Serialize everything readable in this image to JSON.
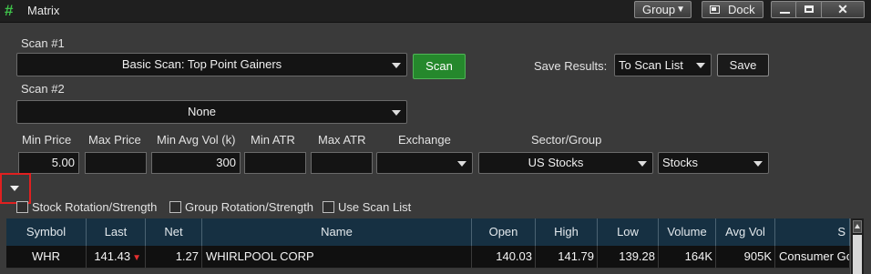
{
  "window": {
    "title": "Matrix",
    "group_label": "Group",
    "dock_label": "Dock",
    "close_glyph": "✕"
  },
  "scan1": {
    "label": "Scan #1",
    "value": "Basic Scan: Top Point Gainers",
    "button": "Scan"
  },
  "save": {
    "label": "Save Results:",
    "value": "To Scan List",
    "button": "Save"
  },
  "scan2": {
    "label": "Scan #2",
    "value": "None"
  },
  "filters": {
    "min_price": {
      "label": "Min Price",
      "value": "5.00"
    },
    "max_price": {
      "label": "Max Price",
      "value": ""
    },
    "min_avg_vol": {
      "label": "Min Avg Vol (k)",
      "value": "300"
    },
    "min_atr": {
      "label": "Min ATR",
      "value": ""
    },
    "max_atr": {
      "label": "Max ATR",
      "value": ""
    },
    "exchange": {
      "label": "Exchange",
      "value": ""
    },
    "sector_group": {
      "label": "Sector/Group",
      "value": "US Stocks",
      "type_value": "Stocks"
    }
  },
  "options": {
    "stock_rotation": "Stock Rotation/Strength",
    "group_rotation": "Group Rotation/Strength",
    "use_scan_list": "Use Scan List"
  },
  "table": {
    "columns": [
      "Symbol",
      "Last",
      "Net",
      "Name",
      "Open",
      "High",
      "Low",
      "Volume",
      "Avg Vol",
      "S"
    ],
    "rows": [
      {
        "symbol": "WHR",
        "last": "141.43",
        "last_tick": "down",
        "net": "1.27",
        "name": "WHIRLPOOL CORP",
        "open": "140.03",
        "high": "141.79",
        "low": "139.28",
        "volume": "164K",
        "avg_vol": "905K",
        "sector": "Consumer Go"
      }
    ]
  },
  "colors": {
    "accent_green": "#25882c",
    "header_blue": "#163042",
    "highlight_red": "#e02020",
    "tick_down_red": "#e53030"
  },
  "icons": {
    "app": "matrix-grid-icon",
    "dock": "dock-icon",
    "tick_down": "red-down-arrow-icon"
  }
}
